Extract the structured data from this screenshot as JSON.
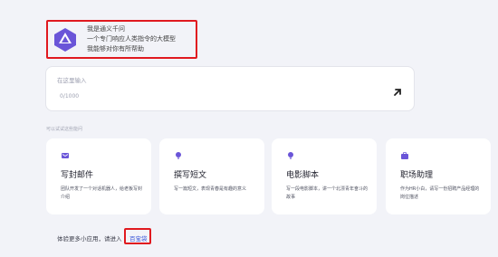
{
  "intro": {
    "line1": "我是通义千问",
    "line2": "一个专门响应人类指令的大模型",
    "line3": "我能够对你有所帮助"
  },
  "input": {
    "placeholder": "在这里输入",
    "counter": "0/1000"
  },
  "section_label": "可以试试这些能问",
  "cards": [
    {
      "title": "写封邮件",
      "desc": "团队开发了一个对话机器人，给老板写封介绍"
    },
    {
      "title": "撰写短文",
      "desc": "写一篇短文，表现青春是有趣的意义"
    },
    {
      "title": "电影脚本",
      "desc": "写一段电影脚本，讲一个北漂青年奋斗的故事"
    },
    {
      "title": "职场助理",
      "desc": "作为HR小白，请写一份招聘产品经理的岗位描述"
    }
  ],
  "footer": {
    "text": "体验更多小应用，请进入",
    "link": "百宝袋"
  },
  "colors": {
    "accent": "#3e59d9",
    "highlight": "#e0191f",
    "logo": "#5b46c9"
  },
  "icons": {
    "logo": "tongyi-logo-icon",
    "send": "arrow-up-right-icon",
    "card_icons": [
      "mail-icon",
      "pen-icon",
      "film-icon",
      "briefcase-icon"
    ]
  }
}
